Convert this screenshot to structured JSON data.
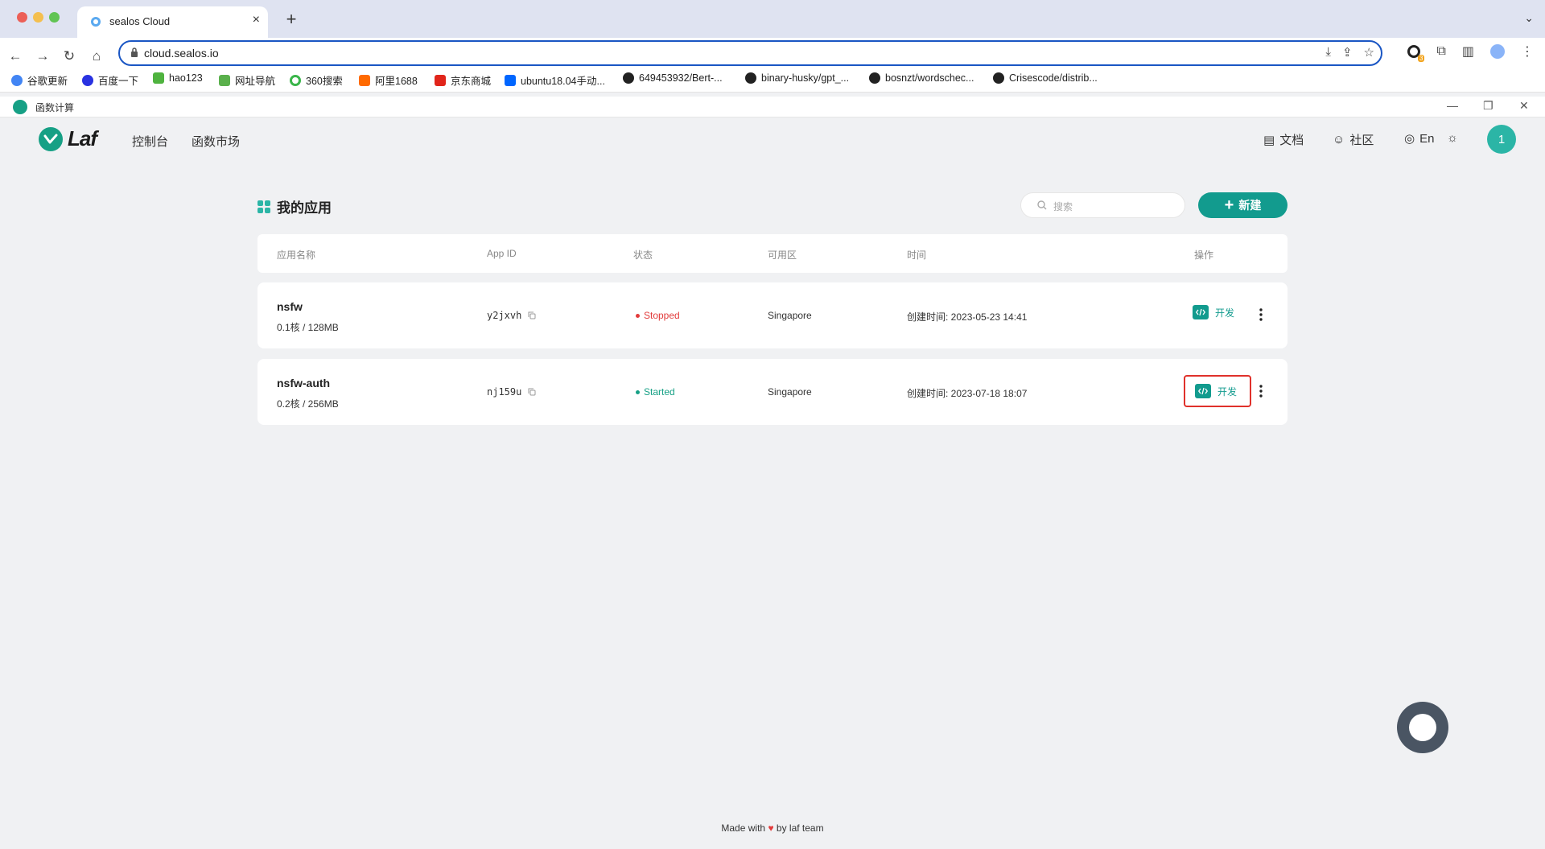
{
  "browser": {
    "tab_title": "sealos Cloud",
    "url": "cloud.sealos.io",
    "extension_badge": "3",
    "bookmarks": [
      "谷歌更新",
      "百度一下",
      "hao123",
      "网址导航",
      "360搜索",
      "阿里1688",
      "京东商城",
      "ubuntu18.04手动...",
      "649453932/Bert-...",
      "binary-husky/gpt_...",
      "bosnzt/wordschec...",
      "Crisescode/distrib..."
    ]
  },
  "appbar": {
    "title": "函数计算"
  },
  "header": {
    "logo_text": "Laf",
    "nav": [
      "控制台",
      "函数市场"
    ],
    "docs": "文档",
    "community": "社区",
    "language": "En",
    "avatar": "1"
  },
  "main": {
    "title": "我的应用",
    "search_placeholder": "搜索",
    "new_button": "新建",
    "columns": [
      "应用名称",
      "App ID",
      "状态",
      "可用区",
      "时间",
      "操作"
    ],
    "apps": [
      {
        "name": "nsfw",
        "spec": "0.1核 / 128MB",
        "app_id": "y2jxvh",
        "status": "Stopped",
        "zone": "Singapore",
        "time": "创建时间: 2023-05-23 14:41",
        "action": "开发"
      },
      {
        "name": "nsfw-auth",
        "spec": "0.2核 / 256MB",
        "app_id": "nj159u",
        "status": "Started",
        "zone": "Singapore",
        "time": "创建时间: 2023-07-18 18:07",
        "action": "开发"
      }
    ]
  },
  "footer": {
    "before": "Made with",
    "after": "by laf team"
  },
  "colors": {
    "accent": "#129b8e",
    "stopped": "#e23b3b",
    "started": "#16a085",
    "highlight": "#e0312b"
  }
}
